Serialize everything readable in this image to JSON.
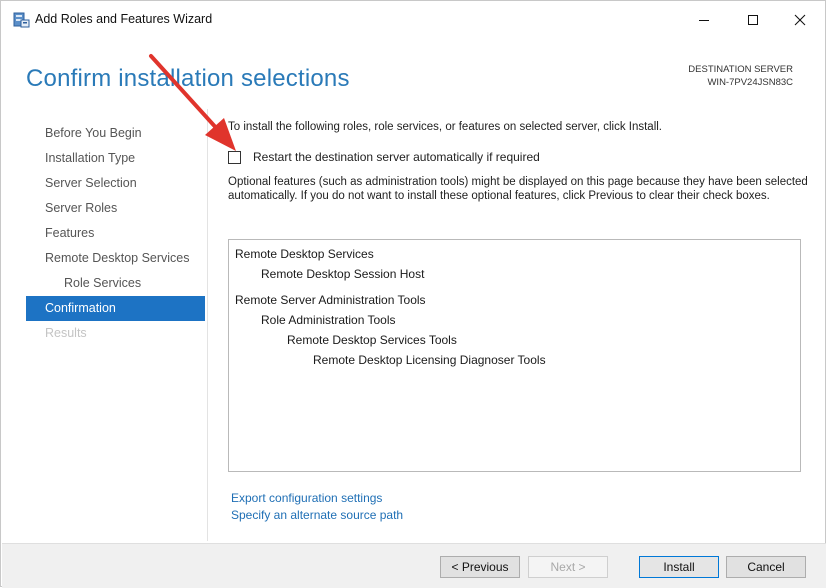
{
  "window": {
    "title": "Add Roles and Features Wizard"
  },
  "header": {
    "page_title": "Confirm installation selections",
    "destination_label": "DESTINATION SERVER",
    "destination_value": "WIN-7PV24JSN83C"
  },
  "nav": {
    "items": [
      {
        "label": "Before You Begin",
        "state": "normal"
      },
      {
        "label": "Installation Type",
        "state": "normal"
      },
      {
        "label": "Server Selection",
        "state": "normal"
      },
      {
        "label": "Server Roles",
        "state": "normal"
      },
      {
        "label": "Features",
        "state": "normal"
      },
      {
        "label": "Remote Desktop Services",
        "state": "normal"
      },
      {
        "label": "Role Services",
        "state": "sub"
      },
      {
        "label": "Confirmation",
        "state": "active"
      },
      {
        "label": "Results",
        "state": "disabled"
      }
    ]
  },
  "content": {
    "intro": "To install the following roles, role services, or features on selected server, click Install.",
    "restart_label": "Restart the destination server automatically if required",
    "restart_checked": false,
    "optional_text": "Optional features (such as administration tools) might be displayed on this page because they have been selected automatically. If you do not want to install these optional features, click Previous to clear their check boxes.",
    "selections": [
      "Remote Desktop Services",
      "Remote Desktop Session Host",
      "Remote Server Administration Tools",
      "Role Administration Tools",
      "Remote Desktop Services Tools",
      "Remote Desktop Licensing Diagnoser Tools"
    ],
    "link_export": "Export configuration settings",
    "link_source": "Specify an alternate source path"
  },
  "footer": {
    "previous": "< Previous",
    "next": "Next >",
    "install": "Install",
    "cancel": "Cancel"
  },
  "colors": {
    "accent": "#1d73c4",
    "title": "#2a7ab8",
    "annotation_arrow": "#e0342c"
  }
}
